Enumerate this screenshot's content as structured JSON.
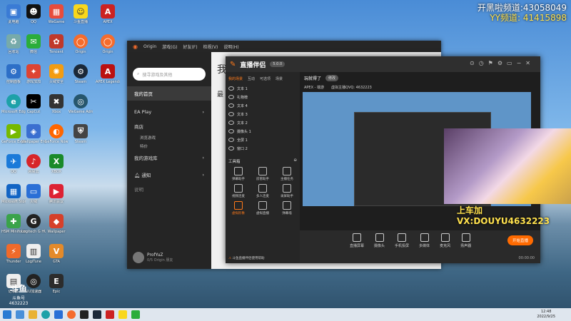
{
  "overlay": {
    "channel_line1": "开黑啦频道:43058049",
    "channel_line2": "YY频道: 41415898",
    "vx_line": "上车加VX:DOUYU4632223"
  },
  "desktop": {
    "col1": [
      "此电脑",
      "回收站",
      "控制面板",
      "Microsoft Edge",
      "GeForce Experience",
      "QQ",
      "Microsoft Store",
      "HSM Miniformance",
      "Thunder",
      "记事本"
    ],
    "col2": [
      "QQ",
      "微信",
      "游戏加加",
      "CapCut",
      "Wallpaper Engine",
      "网易云",
      "火绒",
      "Logitech G HUB",
      "LogiTune",
      "UU加速器"
    ],
    "col3": [
      "WeGame",
      "Tencent",
      "火绒安全",
      "Xbox",
      "GeForce Now",
      "XBOX",
      "腾讯会议",
      "Wallpaper",
      "GTA",
      "Epic"
    ],
    "col4": [
      "斗鱼直播",
      "Origin",
      "Steam",
      "WeGame Admin",
      "Steam",
      "APEX"
    ],
    "col5": [
      "APEX",
      "Origin",
      "APEX Legends"
    ]
  },
  "origin": {
    "title": "Origin",
    "menu": [
      "Origin",
      "游戏(G)",
      "好友(F)",
      "检视(V)",
      "说明(H)"
    ],
    "search_placeholder": "搜寻游戏及其他",
    "items": [
      "我的首页",
      "EA Play",
      "商店",
      "我的游戏库",
      "通知",
      "说明"
    ],
    "store_sub": [
      "浏览游戏",
      "特价"
    ],
    "user_name": "ProfYuZ",
    "user_status": "0/5 Origin 朋友",
    "main_heading": "我的",
    "main_sub": "最"
  },
  "douyu": {
    "brand": "直播伴侣",
    "version": "5.0.0",
    "tabs": [
      "我的场景",
      "互动",
      "可选项",
      "场景"
    ],
    "sources": [
      "文本 1",
      "礼物榜",
      "文本 4",
      "文本 3",
      "文本 2",
      "摄像头 1",
      "全屏 1",
      "窗口 2"
    ],
    "tools_title": "工具箱",
    "tools": [
      "弹幕助手",
      "房管助手",
      "主播任务",
      "视频连麦",
      "多人连麦",
      "录屏助手",
      "虚拟形象",
      "虚拟直播",
      "弹幕墙",
      "更多"
    ],
    "stream_title": "玩就得了",
    "stream_tag": "修改",
    "live_info": [
      "APEX - 端游",
      "虚拟主播QVQ: 4632223"
    ],
    "bottom": [
      "直播屏幕",
      "摄像头",
      "手机投屏",
      "多媒体",
      "麦克风",
      "扬声器"
    ],
    "start_live": "开始直播",
    "notice": "斗鱼直播伴侣使用帮助",
    "timer": "00:00:00"
  },
  "taskbar": {
    "time": "12:48",
    "date": "2022/9/25"
  },
  "watermark": {
    "line1": "斗鱼",
    "line2": "斗鱼号",
    "line3": "4632223"
  },
  "colors": {
    "accent": "#ff6a00",
    "overlay_text": "#ffffff",
    "vx_text": "#ffe14d"
  }
}
